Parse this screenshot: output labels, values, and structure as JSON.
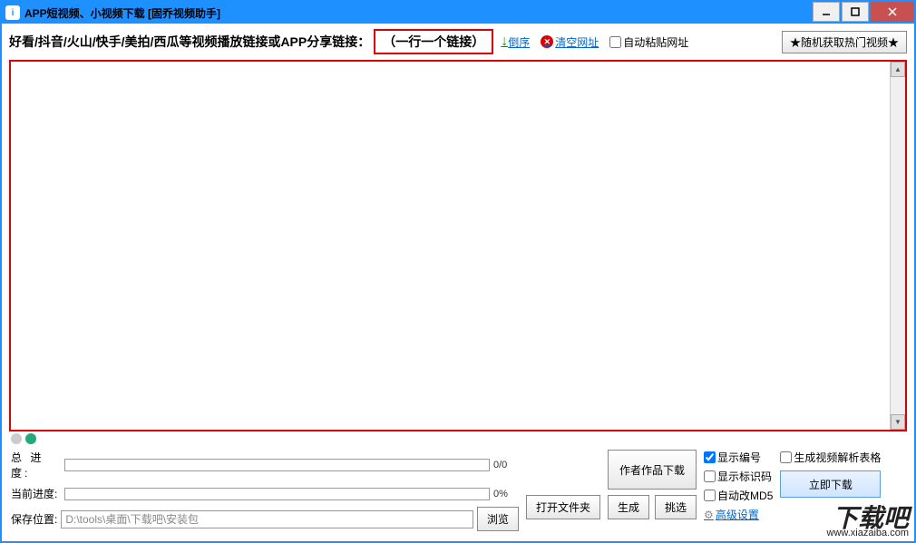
{
  "window": {
    "title": "APP短视频、小视频下载 [固乔视频助手]"
  },
  "toolbar": {
    "label": "好看/抖音/火山/快手/美拍/西瓜等视频播放链接或APP分享链接：",
    "hint_button": "（一行一个链接）",
    "sort_label": "倒序",
    "clear_label": "清空网址",
    "auto_paste_label": "自动粘贴网址",
    "random_button": "★随机获取热门视频★"
  },
  "textarea": {
    "value": ""
  },
  "progress": {
    "total_label": "总 进 度:",
    "total_value": "0/0",
    "current_label": "当前进度:",
    "current_value": "0%"
  },
  "save": {
    "label": "保存位置:",
    "path": "D:\\tools\\桌面\\下载吧\\安装包",
    "browse": "浏览",
    "open_folder": "打开文件夹"
  },
  "mid": {
    "author_btn": "作者作品下载",
    "gen_btn": "生成",
    "pick_btn": "挑选"
  },
  "options": {
    "show_number": "显示编号",
    "show_number_checked": true,
    "show_id": "显示标识码",
    "show_id_checked": false,
    "auto_md5": "自动改MD5",
    "auto_md5_checked": false,
    "advanced": "高级设置"
  },
  "right": {
    "gen_table": "生成视频解析表格",
    "gen_table_checked": false,
    "download_now": "立即下载"
  },
  "watermark": {
    "big": "下载吧",
    "small": "www.xiazaiba.com"
  }
}
